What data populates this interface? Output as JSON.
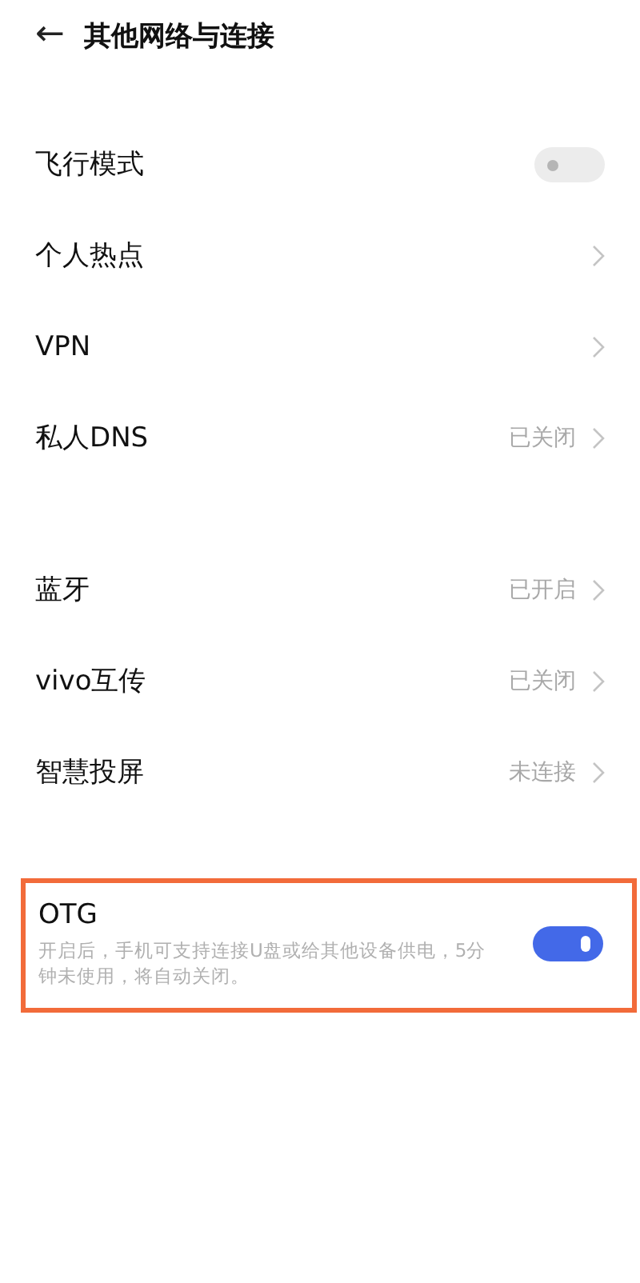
{
  "header": {
    "back": "←",
    "title": "其他网络与连接"
  },
  "groups": [
    {
      "rows": [
        {
          "kind": "toggle",
          "label": "飞行模式",
          "on": false
        },
        {
          "kind": "link",
          "label": "个人热点"
        },
        {
          "kind": "link",
          "label": "VPN"
        },
        {
          "kind": "link",
          "label": "私人DNS",
          "value": "已关闭"
        }
      ]
    },
    {
      "rows": [
        {
          "kind": "link",
          "label": "蓝牙",
          "value": "已开启"
        },
        {
          "kind": "link",
          "label": "vivo互传",
          "value": "已关闭"
        },
        {
          "kind": "link",
          "label": "智慧投屏",
          "value": "未连接"
        }
      ]
    },
    {
      "rows": [
        {
          "kind": "toggle",
          "label": "OTG",
          "on": true,
          "highlighted": true,
          "description": "开启后，手机可支持连接U盘或给其他设备供电，5分钟未使用，将自动关闭。"
        }
      ]
    }
  ]
}
